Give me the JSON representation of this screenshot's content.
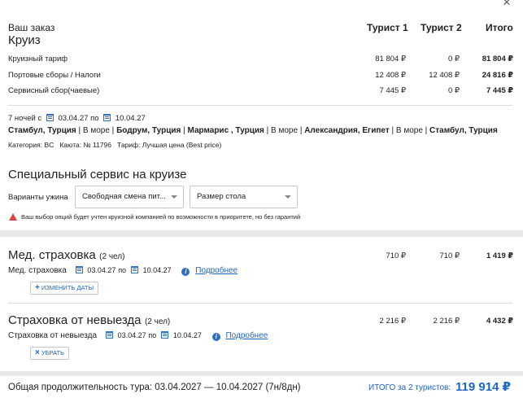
{
  "close_icon": "close-icon",
  "order": {
    "title": "Ваш заказ",
    "subtitle": "Круиз",
    "columns": [
      "Турист 1",
      "Турист 2",
      "Итого"
    ],
    "rows": [
      {
        "label": "Круизный тариф",
        "t1": "81 804 ₽",
        "t2": "0 ₽",
        "total": "81 804 ₽"
      },
      {
        "label": "Портовые сборы / Налоги",
        "t1": "12 408 ₽",
        "t2": "12 408 ₽",
        "total": "24 816 ₽"
      },
      {
        "label": "Сервисный сбор(чаевые)",
        "t1": "7 445 ₽",
        "t2": "0 ₽",
        "total": "7 445 ₽"
      }
    ]
  },
  "cruise": {
    "nights_prefix": "7 ночей с",
    "date_from": "03.04.27",
    "date_sep": "по",
    "date_to": "10.04.27",
    "route": [
      {
        "text": "Стамбул, Турция",
        "bold": true
      },
      {
        "text": " | В море | ",
        "bold": false
      },
      {
        "text": "Бодрум, Турция",
        "bold": true
      },
      {
        "text": " | ",
        "bold": false
      },
      {
        "text": "Мармарис , Турция",
        "bold": true
      },
      {
        "text": " | В море | ",
        "bold": false
      },
      {
        "text": "Александрия, Египет",
        "bold": true
      },
      {
        "text": " | В море | ",
        "bold": false
      },
      {
        "text": "Стамбул, Турция",
        "bold": true
      }
    ],
    "details": "Категория: BC   Каюта: № 11796   Тариф: Лучшая цена (Best price)"
  },
  "special": {
    "title": "Специальный сервис на круизе",
    "dinner_label": "Варианты ужина",
    "dinner_value": "Свободная смена пит...",
    "table_value": "Размер стола",
    "warning": "Ваш выбор опций будет учтен круизной компанией по возможности в приоритете, но без гарантий"
  },
  "insurance_med": {
    "title": "Мед. страховка",
    "count": "(2 чел)",
    "t1": "710 ₽",
    "t2": "710 ₽",
    "total": "1 419 ₽",
    "label": "Мед. страховка",
    "date_from": "03.04.27",
    "date_sep": "по",
    "date_to": "10.04.27",
    "more": "Подробнее",
    "button": "ИЗМЕНИТЬ ДАТЫ"
  },
  "insurance_cancel": {
    "title": "Страховка от невыезда",
    "count": "(2 чел)",
    "t1": "2 216 ₽",
    "t2": "2 216 ₽",
    "total": "4 432 ₽",
    "label": "Страховка от невыезда",
    "date_from": "03.04.27",
    "date_sep": "по",
    "date_to": "10.04.27",
    "more": "Подробнее",
    "button": "УБРАТЬ"
  },
  "footer": {
    "duration": "Общая продолжительность тура: 03.04.2027 — 10.04.2027 (7н/8дн)",
    "total_label": "ИТОГО за 2 туристов:",
    "total_value": "119 914 ₽"
  },
  "colors": {
    "accent": "#1f66c1",
    "warning": "#d9453c",
    "background": "#e9e9e9"
  }
}
